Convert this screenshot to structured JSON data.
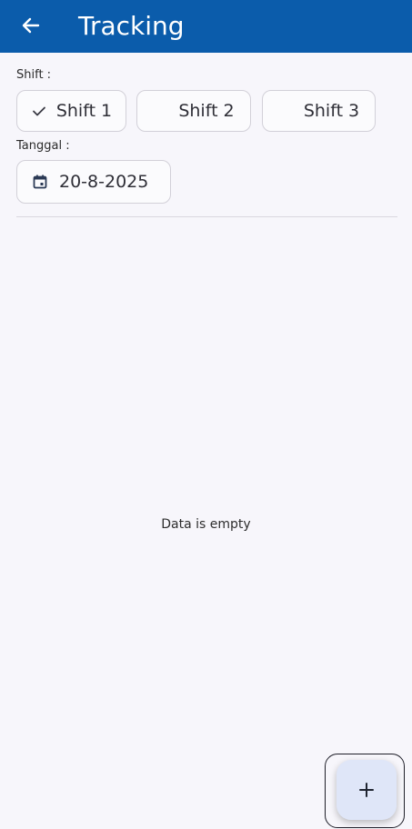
{
  "appbar": {
    "title": "Tracking",
    "back_icon": "arrow-left-icon"
  },
  "shift": {
    "label": "Shift :",
    "options": [
      "Shift 1",
      "Shift 2",
      "Shift 3"
    ],
    "selected": "Shift 1",
    "check_icon": "check-icon"
  },
  "date": {
    "label": "Tanggal :",
    "value": "20-8-2025",
    "icon": "calendar-icon"
  },
  "content": {
    "empty_text": "Data is empty"
  },
  "fab": {
    "icon": "plus-icon"
  },
  "colors": {
    "primary": "#0b5cab",
    "background": "#f7f6fb",
    "fab_background": "#dfe6f8"
  }
}
